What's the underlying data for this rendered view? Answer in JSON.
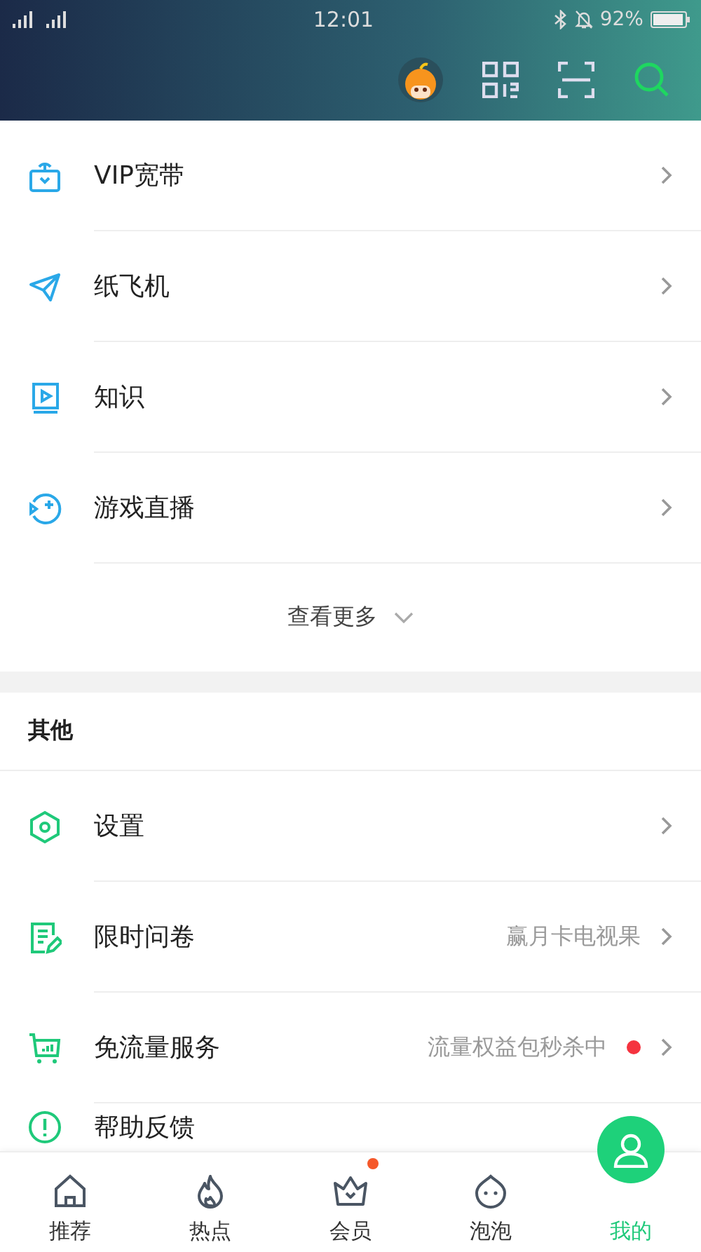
{
  "status_bar": {
    "time": "12:01",
    "battery": "92%"
  },
  "services": {
    "items": [
      {
        "label": "VIP宽带"
      },
      {
        "label": "纸飞机"
      },
      {
        "label": "知识"
      },
      {
        "label": "游戏直播"
      }
    ],
    "more_button": "查看更多"
  },
  "other": {
    "title": "其他",
    "items": [
      {
        "label": "设置"
      },
      {
        "label": "限时问卷",
        "value": "赢月卡电视果"
      },
      {
        "label": "免流量服务",
        "value": "流量权益包秒杀中",
        "dot": true
      },
      {
        "label": "帮助反馈"
      }
    ]
  },
  "tabs": [
    {
      "label": "推荐",
      "selected": false
    },
    {
      "label": "热点",
      "selected": false
    },
    {
      "label": "会员",
      "selected": false,
      "dot": true
    },
    {
      "label": "泡泡",
      "selected": false
    },
    {
      "label": "我的",
      "selected": true
    }
  ]
}
